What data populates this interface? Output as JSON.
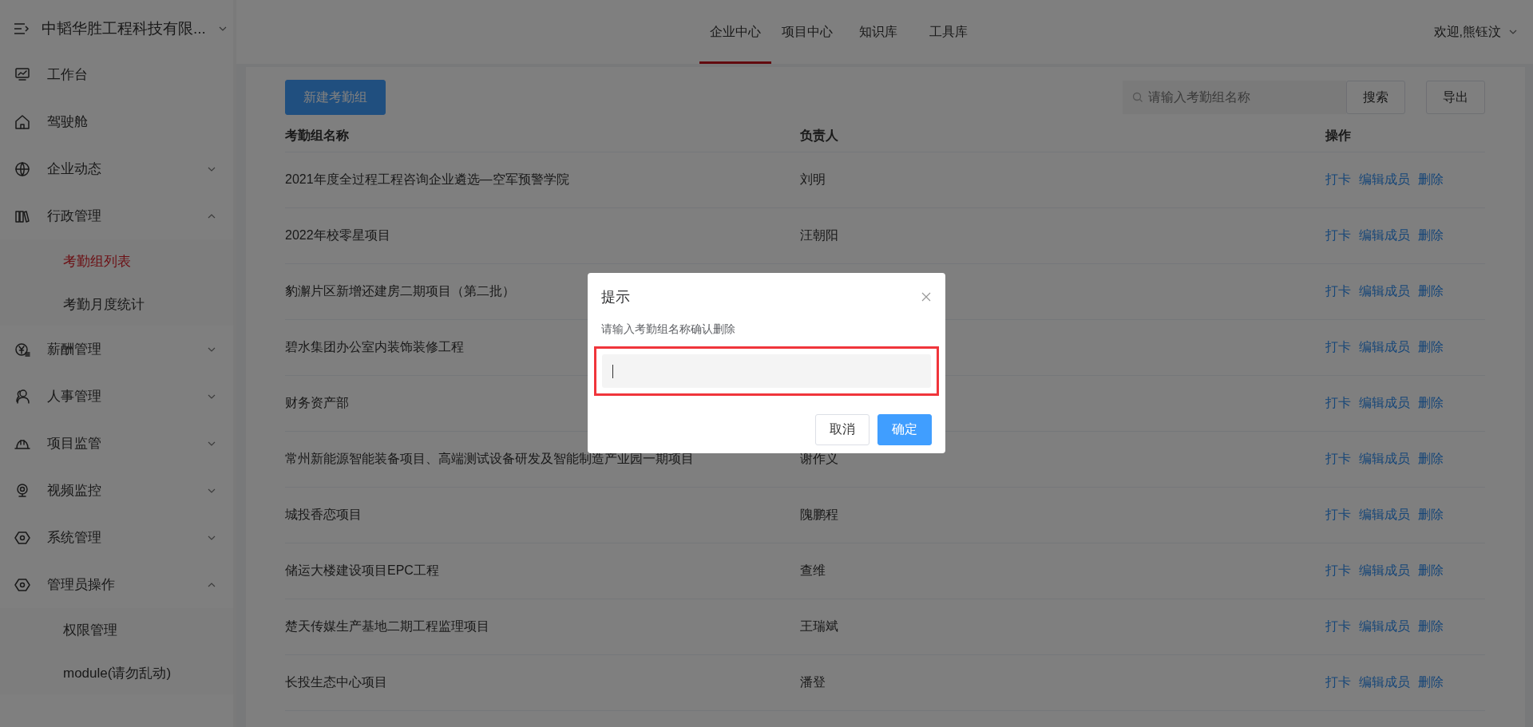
{
  "sidebar": {
    "company": "中韬华胜工程科技有限...",
    "items": [
      {
        "label": "工作台",
        "kind": "link"
      },
      {
        "label": "驾驶舱",
        "kind": "link"
      },
      {
        "label": "企业动态",
        "kind": "group",
        "expanded": false
      },
      {
        "label": "行政管理",
        "kind": "group",
        "expanded": true,
        "children": [
          {
            "label": "考勤组列表",
            "selected": true
          },
          {
            "label": "考勤月度统计",
            "selected": false
          }
        ]
      },
      {
        "label": "薪酬管理",
        "kind": "group",
        "expanded": false
      },
      {
        "label": "人事管理",
        "kind": "group",
        "expanded": false
      },
      {
        "label": "项目监管",
        "kind": "group",
        "expanded": false
      },
      {
        "label": "视频监控",
        "kind": "group",
        "expanded": false
      },
      {
        "label": "系统管理",
        "kind": "group",
        "expanded": false
      },
      {
        "label": "管理员操作",
        "kind": "group",
        "expanded": true,
        "children": [
          {
            "label": "权限管理",
            "selected": false
          },
          {
            "label": "module(请勿乱动)",
            "selected": false
          }
        ]
      }
    ]
  },
  "top_nav": {
    "tabs": [
      {
        "label": "企业中心",
        "selected": true
      },
      {
        "label": "项目中心",
        "selected": false
      },
      {
        "label": "知识库",
        "selected": false
      },
      {
        "label": "工具库",
        "selected": false
      }
    ],
    "user": "欢迎,熊钰汶"
  },
  "toolbar": {
    "new_button": "新建考勤组",
    "search": {
      "placeholder": "请输入考勤组名称"
    },
    "search_button": "搜索",
    "export_button": "导出"
  },
  "table": {
    "columns": [
      "考勤组名称",
      "负责人",
      "操作"
    ],
    "rows": [
      {
        "name": "2021年度全过程工程咨询企业遴选—空军预警学院",
        "owner": "刘明",
        "actions": [
          "打卡",
          "编辑成员",
          "删除"
        ]
      },
      {
        "name": "2022年校零星项目",
        "owner": "汪朝阳",
        "actions": [
          "打卡",
          "编辑成员",
          "删除"
        ]
      },
      {
        "name": "豹澥片区新增还建房二期项目（第二批）",
        "actions": [
          "打卡",
          "编辑成员",
          "删除"
        ]
      },
      {
        "name": "碧水集团办公室内装饰装修工程",
        "actions": [
          "打卡",
          "编辑成员",
          "删除"
        ]
      },
      {
        "name": "财务资产部",
        "actions": [
          "打卡",
          "编辑成员",
          "删除"
        ]
      },
      {
        "name": "常州新能源智能装备项目、高端测试设备研发及智能制造产业园一期项目",
        "owner": "谢作义",
        "actions": [
          "打卡",
          "编辑成员",
          "删除"
        ]
      },
      {
        "name": "城投香恋项目",
        "owner": "隗鹏程",
        "actions": [
          "打卡",
          "编辑成员",
          "删除"
        ]
      },
      {
        "name": "储运大楼建设项目EPC工程",
        "owner": "查维",
        "actions": [
          "打卡",
          "编辑成员",
          "删除"
        ]
      },
      {
        "name": "楚天传媒生产基地二期工程监理项目",
        "owner": "王瑞斌",
        "actions": [
          "打卡",
          "编辑成员",
          "删除"
        ]
      },
      {
        "name": "长投生态中心项目",
        "owner": "潘登",
        "actions": [
          "打卡",
          "编辑成员",
          "删除"
        ]
      }
    ]
  },
  "dialog": {
    "title": "提示",
    "message": "请输入考勤组名称确认删除",
    "input": {
      "focused": true,
      "highlighted": true
    },
    "buttons": [
      {
        "label": "取消",
        "kind": "default"
      },
      {
        "label": "确定",
        "kind": "primary"
      }
    ]
  }
}
